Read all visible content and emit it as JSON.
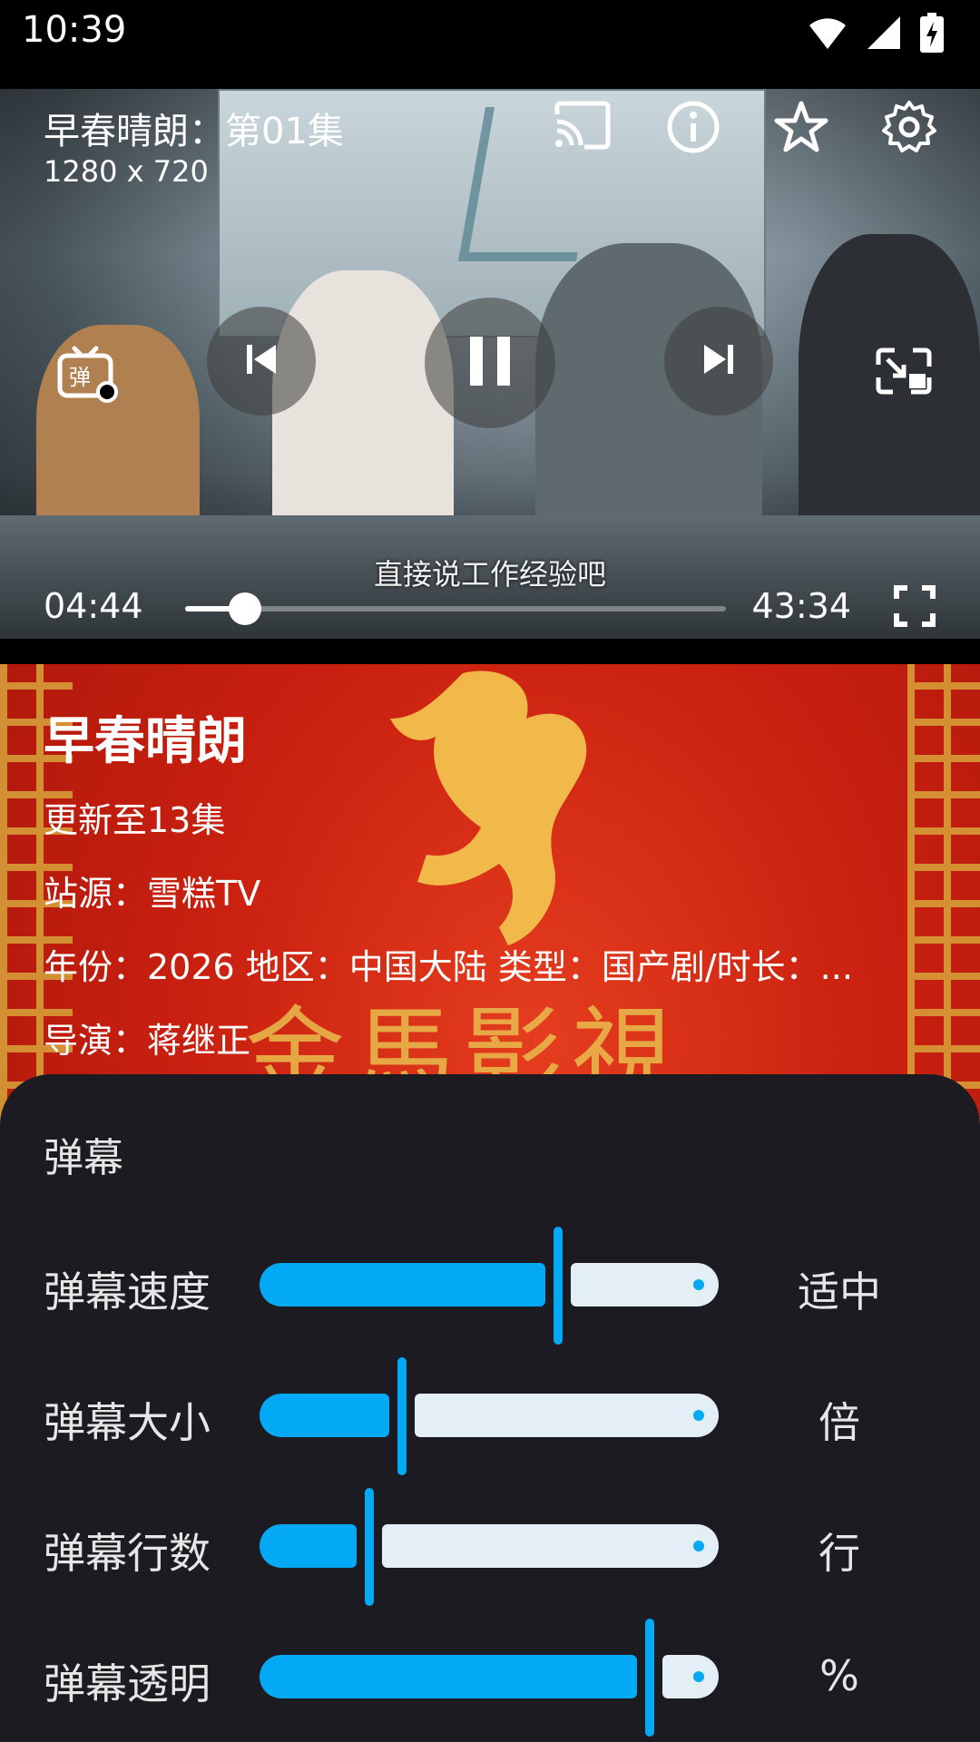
{
  "status_bar": {
    "time": "10:39",
    "icons": [
      "wifi-icon",
      "signal-icon",
      "battery-charging-icon"
    ]
  },
  "player": {
    "title": "早春晴朗：第01集",
    "resolution": "1280 x 720",
    "top_icons": [
      "cast-icon",
      "info-icon",
      "star-icon",
      "settings-icon"
    ],
    "controls": [
      "danmaku-icon",
      "previous-icon",
      "pause-icon",
      "next-icon",
      "pip-icon"
    ],
    "subtitle": "直接说工作经验吧",
    "current_time": "04:44",
    "total_time": "43:34",
    "progress": 0.11,
    "fullscreen_icon": "fullscreen-icon"
  },
  "detail": {
    "title": "早春晴朗",
    "update": "更新至13集",
    "source": "站源：雪糕TV",
    "meta": "年份：2026  地区：中国大陆  类型：国产剧/时长：...",
    "director": "导演：蒋继正"
  },
  "danmaku_sheet": {
    "title": "弹幕",
    "rows": [
      {
        "label": "弹幕速度",
        "value": "适中",
        "fraction": 0.65
      },
      {
        "label": "弹幕大小",
        "value": "倍",
        "fraction": 0.31
      },
      {
        "label": "弹幕行数",
        "value": "行",
        "fraction": 0.24
      },
      {
        "label": "弹幕透明",
        "value": "%",
        "fraction": 0.85
      }
    ]
  },
  "colors": {
    "accent": "#03a9f4",
    "sheet_bg": "#1c1b21",
    "track_inactive": "#e3eef7"
  }
}
